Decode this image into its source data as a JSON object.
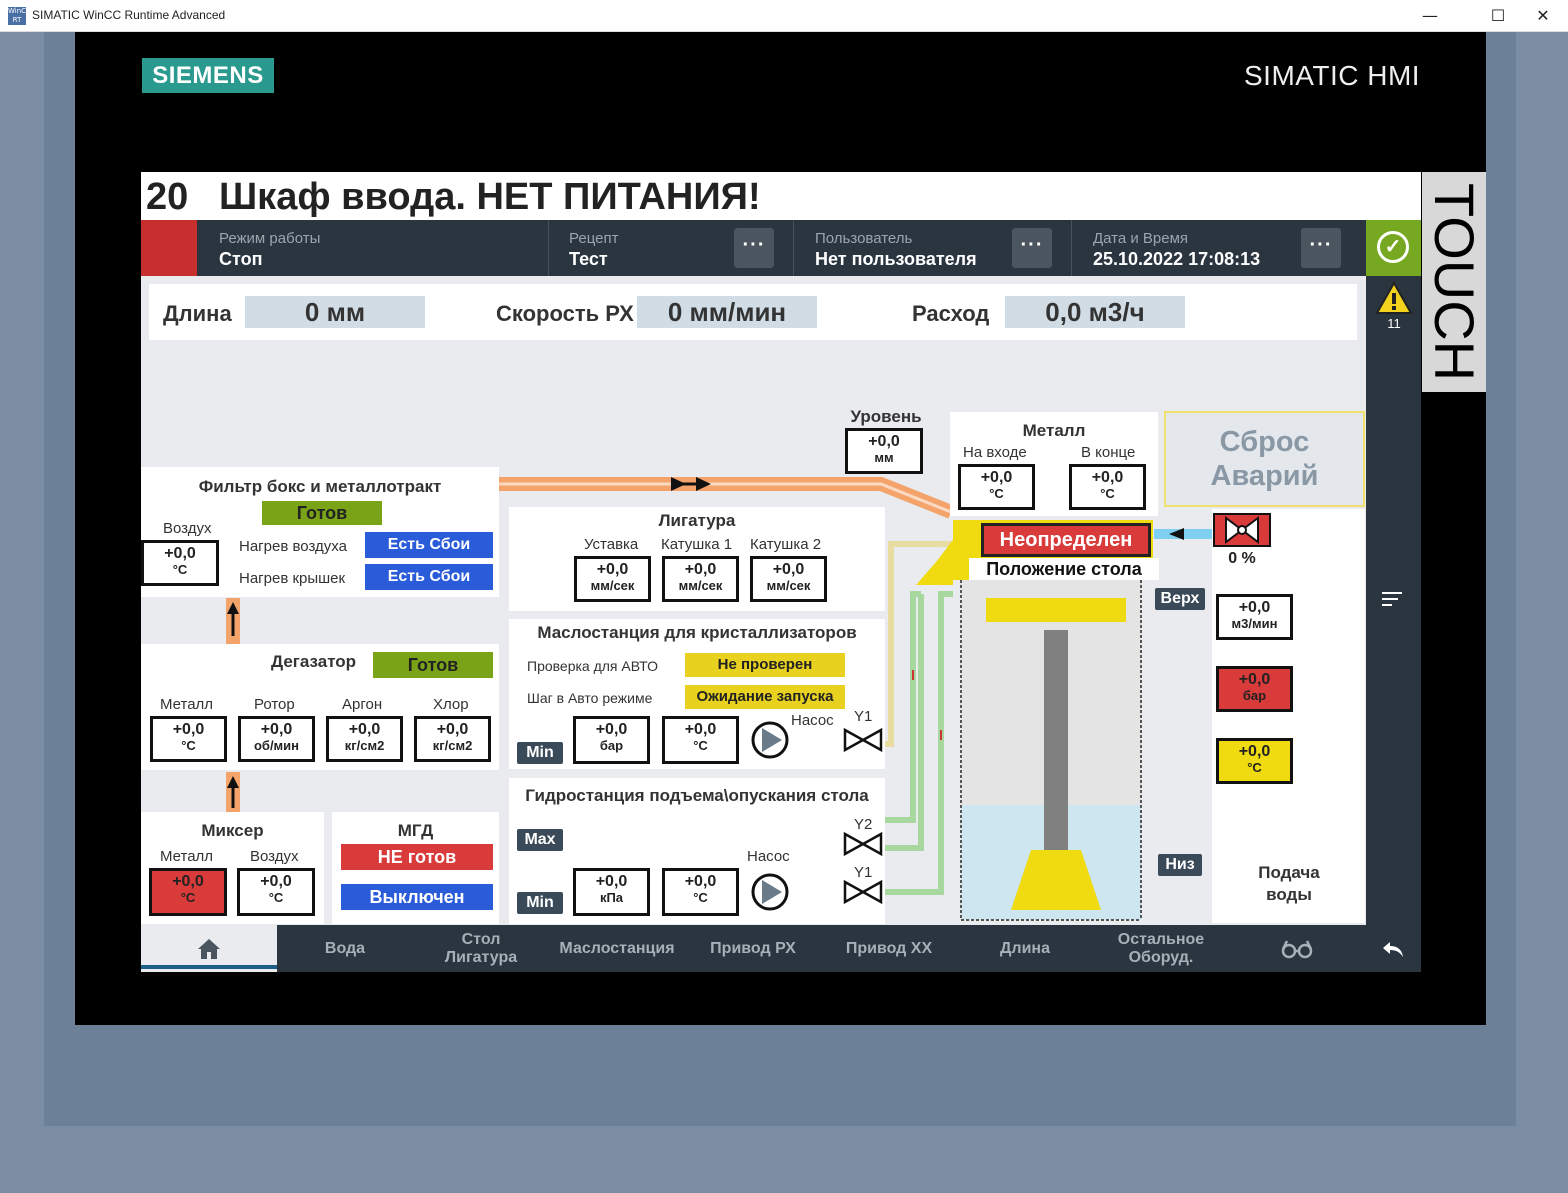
{
  "window": {
    "title": "SIMATIC WinCC Runtime Advanced",
    "icon_text": "WinCC RT",
    "minimize": "—",
    "maximize": "☐",
    "close": "✕"
  },
  "bezel": {
    "brand": "SIEMENS",
    "product": "SIMATIC HMI",
    "touch": "TOUCH"
  },
  "alarm": {
    "number": "20",
    "text": "Шкаф ввода. НЕТ ПИТАНИЯ!"
  },
  "header": {
    "mode_caption": "Режим работы",
    "mode_value": "Стоп",
    "recipe_caption": "Рецепт",
    "recipe_value": "Тест",
    "user_caption": "Пользователь",
    "user_value": "Нет пользователя",
    "datetime_caption": "Дата и Время",
    "datetime_value": "25.10.2022 17:08:13",
    "more": "···",
    "warning_count": "11"
  },
  "measurements": {
    "length_label": "Длина",
    "length_value": "0 мм",
    "speed_label": "Скорость РХ",
    "speed_value": "0 мм/мин",
    "flow_label": "Расход",
    "flow_value": "0,0 м3/ч"
  },
  "filter": {
    "title": "Фильтр бокс и металлотракт",
    "status": "Готов",
    "air_label": "Воздух",
    "air_value": "+0,0",
    "air_unit": "°C",
    "heat_air_label": "Нагрев воздуха",
    "heat_air_status": "Есть Сбои",
    "heat_lid_label": "Нагрев крышек",
    "heat_lid_status": "Есть Сбои"
  },
  "degasser": {
    "title": "Дегазатор",
    "status": "Готов",
    "items": [
      {
        "label": "Металл",
        "value": "+0,0",
        "unit": "°C"
      },
      {
        "label": "Ротор",
        "value": "+0,0",
        "unit": "об/мин"
      },
      {
        "label": "Аргон",
        "value": "+0,0",
        "unit": "кг/см2"
      },
      {
        "label": "Хлор",
        "value": "+0,0",
        "unit": "кг/см2"
      }
    ]
  },
  "mixer": {
    "title": "Миксер",
    "metal_label": "Металл",
    "metal_value": "+0,0",
    "metal_unit": "°C",
    "air_label": "Воздух",
    "air_value": "+0,0",
    "air_unit": "°C"
  },
  "mgd": {
    "title": "МГД",
    "status1": "НЕ готов",
    "status2": "Выключен"
  },
  "level": {
    "label": "Уровень",
    "value": "+0,0",
    "unit": "мм"
  },
  "ligature": {
    "title": "Лигатура",
    "items": [
      {
        "label": "Уставка",
        "value": "+0,0",
        "unit": "мм/сек"
      },
      {
        "label": "Катушка 1",
        "value": "+0,0",
        "unit": "мм/сек"
      },
      {
        "label": "Катушка 2",
        "value": "+0,0",
        "unit": "мм/сек"
      }
    ]
  },
  "oil": {
    "title": "Маслостанция для кристаллизаторов",
    "auto_check_label": "Проверка для АВТО",
    "auto_check_status": "Не проверен",
    "auto_step_label": "Шаг в Авто режиме",
    "auto_step_status": "Ожидание запуска",
    "min": "Min",
    "pressure_value": "+0,0",
    "pressure_unit": "бар",
    "temp_value": "+0,0",
    "temp_unit": "°C",
    "pump_label": "Насос",
    "valve_label": "Y1"
  },
  "hydro": {
    "title": "Гидростанция подъема\\опускания стола",
    "max": "Max",
    "min": "Min",
    "pressure_value": "+0,0",
    "pressure_unit": "кПа",
    "temp_value": "+0,0",
    "temp_unit": "°C",
    "pump_label": "Насос",
    "valve_y2": "Y2",
    "valve_y1": "Y1"
  },
  "metal": {
    "title": "Металл",
    "in_label": "На входе",
    "in_value": "+0,0",
    "in_unit": "°C",
    "out_label": "В конце",
    "out_value": "+0,0",
    "out_unit": "°C"
  },
  "reset": {
    "label": "Сброс Аварий"
  },
  "table": {
    "status": "Неопределен",
    "position_label": "Положение стола",
    "top": "Верх",
    "bottom": "Низ"
  },
  "water": {
    "valve_percent": "0 %",
    "flow_value": "+0,0",
    "flow_unit": "м3/мин",
    "pressure_value": "+0,0",
    "pressure_unit": "бар",
    "temp_value": "+0,0",
    "temp_unit": "°C",
    "label": "Подача воды"
  },
  "nav": {
    "items": [
      "Вода",
      "Стол Лигатура",
      "Маслостанция",
      "Привод РХ",
      "Привод ХХ",
      "Длина",
      "Остальное Оборуд."
    ]
  },
  "colors": {
    "accent_green": "#7aa318",
    "alarm_red": "#c72e2e",
    "header_dark": "#2a3540",
    "status_blue": "#2a5bd8",
    "status_yellow": "#e8d21f"
  }
}
